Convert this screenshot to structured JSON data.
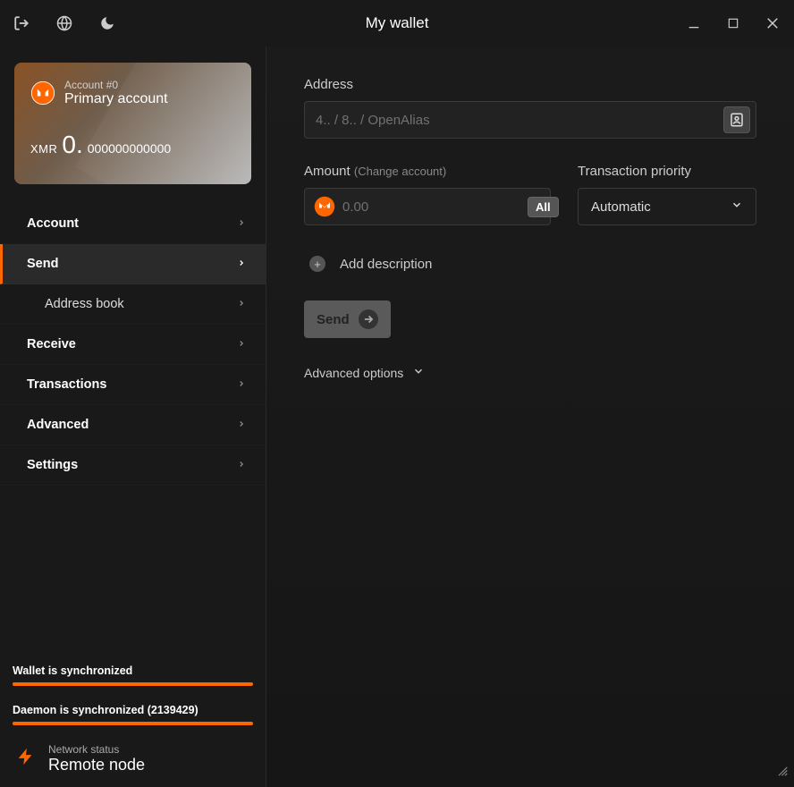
{
  "titlebar": {
    "title": "My wallet"
  },
  "account_card": {
    "account_label": "Account #0",
    "account_name": "Primary account",
    "currency_symbol": "XMR",
    "balance_int": "0.",
    "balance_frac": "000000000000"
  },
  "nav": {
    "items": [
      {
        "label": "Account",
        "active": false,
        "sub": false
      },
      {
        "label": "Send",
        "active": true,
        "sub": false
      },
      {
        "label": "Address book",
        "active": false,
        "sub": true
      },
      {
        "label": "Receive",
        "active": false,
        "sub": false
      },
      {
        "label": "Transactions",
        "active": false,
        "sub": false
      },
      {
        "label": "Advanced",
        "active": false,
        "sub": false
      },
      {
        "label": "Settings",
        "active": false,
        "sub": false
      }
    ]
  },
  "sync": {
    "wallet_label": "Wallet is synchronized",
    "daemon_label": "Daemon is synchronized (2139429)"
  },
  "network": {
    "status_label": "Network status",
    "mode": "Remote node"
  },
  "send_form": {
    "address_label": "Address",
    "address_placeholder": "4.. / 8.. / OpenAlias",
    "amount_label": "Amount",
    "amount_sub": "(Change account)",
    "amount_placeholder": "0.00",
    "all_btn": "All",
    "priority_label": "Transaction priority",
    "priority_value": "Automatic",
    "add_description": "Add description",
    "send_btn": "Send",
    "advanced_options": "Advanced options"
  }
}
